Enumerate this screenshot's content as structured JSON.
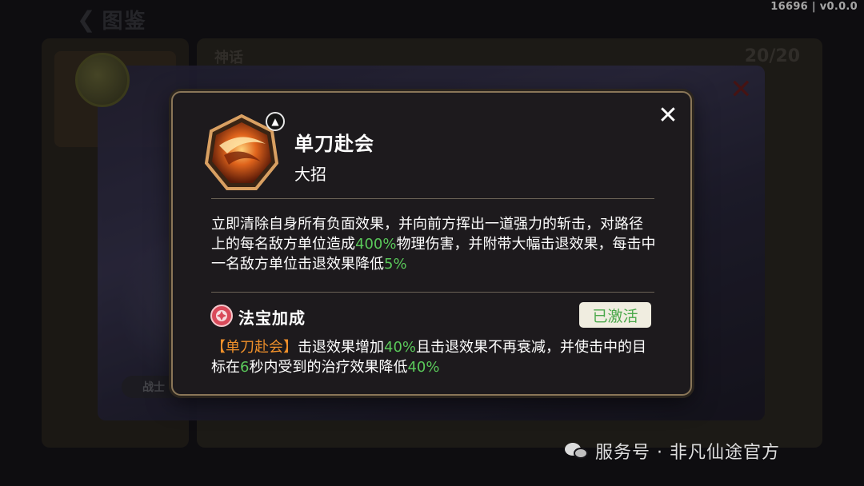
{
  "background": {
    "back_label": "图鉴",
    "panel_title": "神话",
    "count": "20/20",
    "warrior_tag": "战士"
  },
  "version": "16696 | v0.0.0",
  "dialog": {
    "skill_name": "单刀赴会",
    "skill_type": "大招",
    "description": {
      "p1": "立即清除自身所有负面效果，并向前方挥出一道强力的斩击，对路径上的每名敌方单位造成",
      "v1": "400%",
      "p2": "物理伤害，并附带大幅击退效果，每击中一名敌方单位击退效果降低",
      "v2": "5%"
    },
    "fabao": {
      "title": "法宝加成",
      "status": "已激活",
      "tag": "【单刀赴会】",
      "p1": "击退效果增加",
      "v1": "40%",
      "p2": "且击退效果不再衰减，并使击中的目标在",
      "v2": "6",
      "p3": "秒内受到的治疗效果降低",
      "v3": "40%"
    }
  },
  "watermark": "服务号 · 非凡仙途官方",
  "icons": {
    "close": "close-icon",
    "back": "back-arrow-icon",
    "skill": "slash-skill-icon",
    "fabao": "fabao-icon",
    "wechat": "wechat-icon"
  },
  "colors": {
    "highlight_green": "#5ac85a",
    "tag_orange": "#f0902a",
    "dialog_border": "#8a7658",
    "dialog_bg": "#1d1a1d"
  }
}
